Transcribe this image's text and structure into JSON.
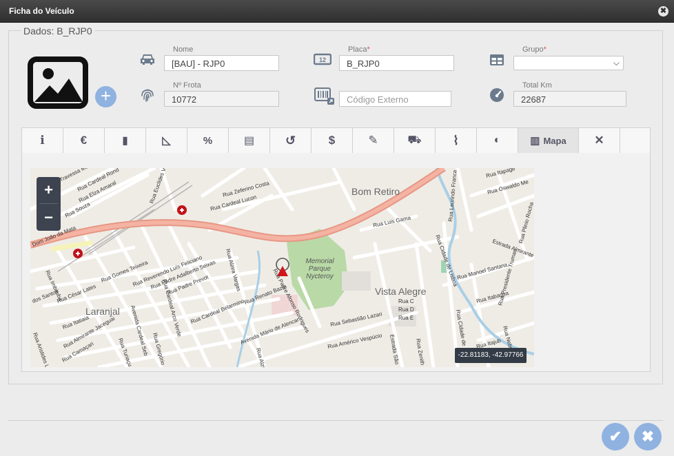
{
  "window": {
    "title": "Ficha do Veículo",
    "close_glyph": "✖"
  },
  "form": {
    "legend": "Dados: B_RJP0",
    "add_photo_glyph": "+",
    "nome": {
      "label": "Nome",
      "value": "[BAU] - RJP0"
    },
    "placa": {
      "label": "Placa",
      "required": "*",
      "value": "B_RJP0"
    },
    "grupo": {
      "label": "Grupo",
      "required": "*",
      "value": ""
    },
    "frota": {
      "label": "Nº Frota",
      "value": "10772"
    },
    "codigo": {
      "placeholder": "Código Externo"
    },
    "km": {
      "label": "Total Km",
      "value": "22687"
    }
  },
  "tabs": [
    {
      "icon": "info-icon",
      "glyph": "i"
    },
    {
      "icon": "euro-icon",
      "glyph": "€"
    },
    {
      "icon": "book-icon",
      "glyph": "▮"
    },
    {
      "icon": "ruler-triangle-icon",
      "glyph": "◺"
    },
    {
      "icon": "percent-icon",
      "glyph": "%"
    },
    {
      "icon": "document-icon",
      "glyph": "▤"
    },
    {
      "icon": "history-icon",
      "glyph": "↺"
    },
    {
      "icon": "dollar-icon",
      "glyph": "$"
    },
    {
      "icon": "wrench-icon",
      "glyph": "✎"
    },
    {
      "icon": "car-front-icon",
      "glyph": "⛟"
    },
    {
      "icon": "paperclip-icon",
      "glyph": "⌇"
    },
    {
      "icon": "toggle-icon",
      "glyph": "◐"
    },
    {
      "icon": "map-icon",
      "glyph": "▥",
      "label": "Mapa",
      "active": true
    },
    {
      "icon": "tools-icon",
      "glyph": "✕"
    }
  ],
  "map": {
    "zoom_in": "+",
    "zoom_out": "−",
    "coordinates": "-22.81183, -42.97766",
    "places": [
      "Bom Retiro",
      "Memorial",
      "Parque",
      "Nycteroy",
      "Vista Alegre",
      "Laranjal"
    ],
    "streets": [
      "Travessa Ma",
      "Rua Cardeal Rond",
      "Rua Elza Amaral",
      "Rua Euclides V",
      "Rua Souza",
      "Rua Zeferino Costa",
      "Rua Cardeal Lucon",
      "Rua Luis Gama",
      "Rua Laurindo Franca",
      "Rua Itapage",
      "Rua Oswaldo Me",
      "Rua Plinio Rocha",
      "Estrada Almirante",
      "Rua Cidade de Lisboa",
      "Rua Manoel Santana",
      "Rua Presidente Truman",
      "Rua Itabagua",
      "Rua Nebraska",
      "Rua Sebastião Lazari",
      "Rua Américo Vespúcio",
      "Estrada São",
      "Rua Zenith",
      "Rua C",
      "Rua D",
      "Rua E",
      "Rua Padre Afonso Rodrigues",
      "Avenida Mário de Alencar",
      "Rua Renato Bazin",
      "Rua Cardeal Belarmino",
      "Rua Alzira Vargas",
      "Rua Padre Prevot",
      "Rua Padre Adalberto Seixas",
      "Rua Reverendo Luís Feliciano",
      "Rua Gomes Teixeira",
      "Rua César Lates",
      "Rua Imbituba",
      "dos Santos",
      "Rua Itatiaia",
      "Rua Almirante Jaceguai",
      "Rua Camaçari",
      "Rua Aristides Lima",
      "Rua Turiaçu",
      "Avenida Cardeal Seb",
      "Rua Cardeal Arco Verde",
      "Rua Gregório",
      "Dom João da Mata",
      "Rua Cidade de",
      "Rua Itajub",
      "Rua Alzi"
    ]
  },
  "footer": {
    "confirm_glyph": "✔",
    "cancel_glyph": "✖"
  }
}
